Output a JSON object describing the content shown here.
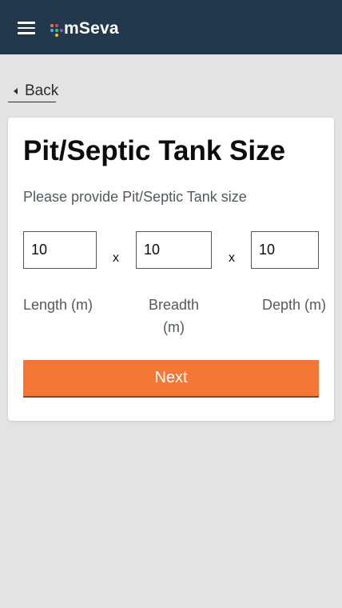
{
  "header": {
    "menu_icon": "hamburger-menu-icon",
    "logo_text": "mSeva",
    "logo_dot_colors": [
      "#f47738",
      "#e0483a",
      "#41b6e6",
      "#2ecc71",
      "#f1c40f",
      "#9b59b6"
    ]
  },
  "back": {
    "label": "Back",
    "icon": "caret-left-icon"
  },
  "form": {
    "title": "Pit/Septic Tank Size",
    "subtitle": "Please provide Pit/Septic Tank size",
    "fields": [
      {
        "label": "Length (m)",
        "value": "10"
      },
      {
        "label": "Breadth (m)",
        "value": "10"
      },
      {
        "label": "Depth (m)",
        "value": "10"
      }
    ],
    "multiplier_symbol": "x",
    "next_label": "Next"
  },
  "colors": {
    "header_bg": "#22394d",
    "page_bg": "#e3e3e3",
    "card_bg": "#ffffff",
    "primary_button": "#f47738",
    "text_primary": "#0b0c0c",
    "text_secondary": "#505a5f"
  }
}
